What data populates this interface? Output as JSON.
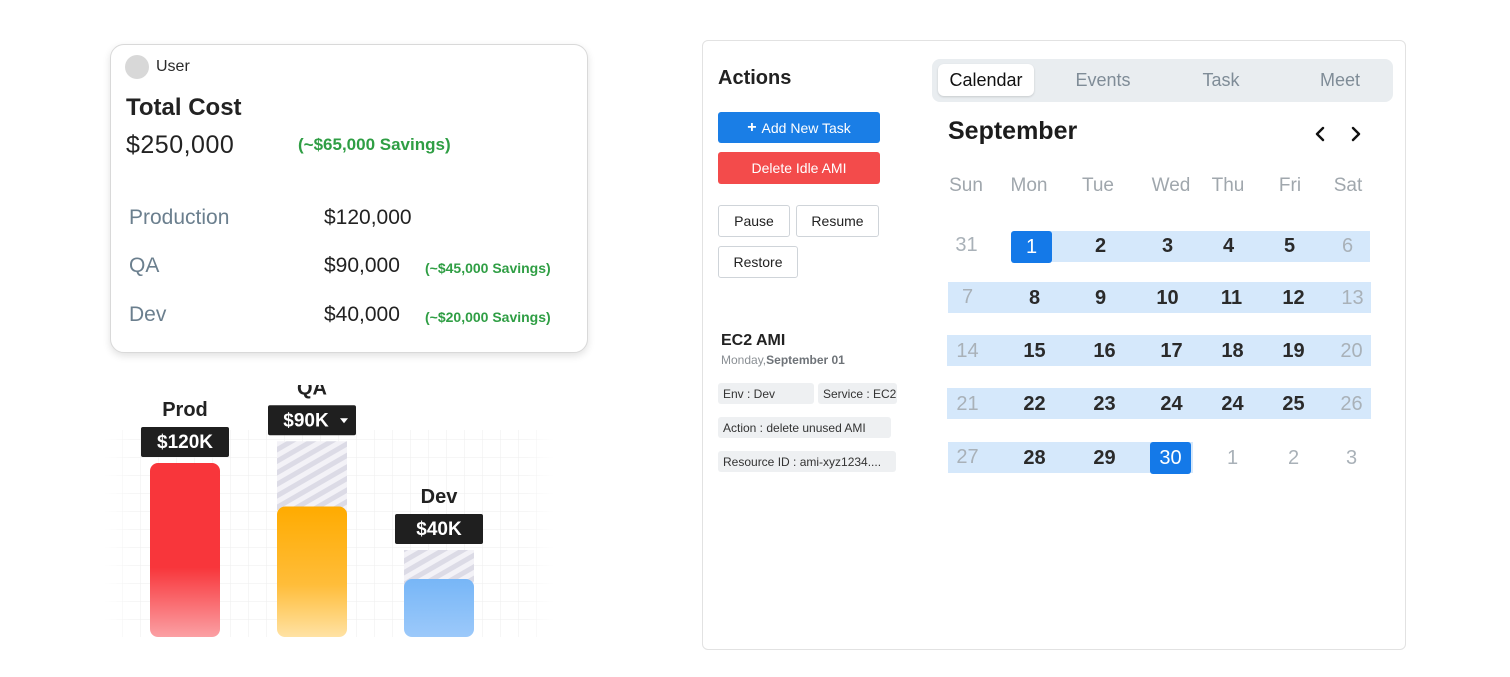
{
  "cost_card": {
    "user_label": "User",
    "total_label": "Total Cost",
    "total_value": "$250,000",
    "total_savings": "(~$65,000 Savings)",
    "rows": [
      {
        "name": "Production",
        "cost": "$120,000",
        "savings": ""
      },
      {
        "name": "QA",
        "cost": "$90,000",
        "savings": "(~$45,000 Savings)"
      },
      {
        "name": "Dev",
        "cost": "$40,000",
        "savings": "(~$20,000 Savings)"
      }
    ]
  },
  "chart_data": {
    "type": "bar",
    "categories": [
      "Prod",
      "QA",
      "Dev"
    ],
    "values": [
      120,
      90,
      40
    ],
    "savings": [
      0,
      45,
      20
    ],
    "value_labels": [
      "$120K",
      "$90K",
      "$40K"
    ],
    "units": "K USD",
    "ylim": [
      0,
      120
    ],
    "grid": true,
    "legend": "none",
    "colors": [
      "#f8363b",
      "#ffab00",
      "#77b6f7"
    ]
  },
  "actions": {
    "title": "Actions",
    "add_task": "Add New Task",
    "delete_ami": "Delete Idle AMI",
    "pause": "Pause",
    "resume": "Resume",
    "restore": "Restore"
  },
  "event": {
    "title": "EC2 AMI",
    "day": "Monday,",
    "date": "September 01",
    "env": "Env : Dev",
    "service": "Service : EC2",
    "action": "Action : delete unused AMI",
    "resource": "Resource ID : ami-xyz1234...."
  },
  "tabs": [
    "Calendar",
    "Events",
    "Task",
    "Meet"
  ],
  "active_tab": "Calendar",
  "calendar": {
    "month": "September",
    "weekdays": [
      "Sun",
      "Mon",
      "Tue",
      "Wed",
      "Thu",
      "Fri",
      "Sat"
    ],
    "weeks": [
      [
        "31",
        "1",
        "2",
        "3",
        "4",
        "5",
        "6"
      ],
      [
        "7",
        "8",
        "9",
        "10",
        "11",
        "12",
        "13"
      ],
      [
        "14",
        "15",
        "16",
        "17",
        "18",
        "19",
        "20"
      ],
      [
        "21",
        "22",
        "23",
        "24",
        "24",
        "25",
        "26"
      ],
      [
        "27",
        "28",
        "29",
        "30",
        "1",
        "2",
        "3"
      ]
    ],
    "selected_start": "1",
    "selected_end": "30"
  },
  "colors": {
    "primary": "#1a7ee6",
    "danger": "#f34b4b",
    "savings": "#2f9e44",
    "range": "#d5e8fb"
  }
}
